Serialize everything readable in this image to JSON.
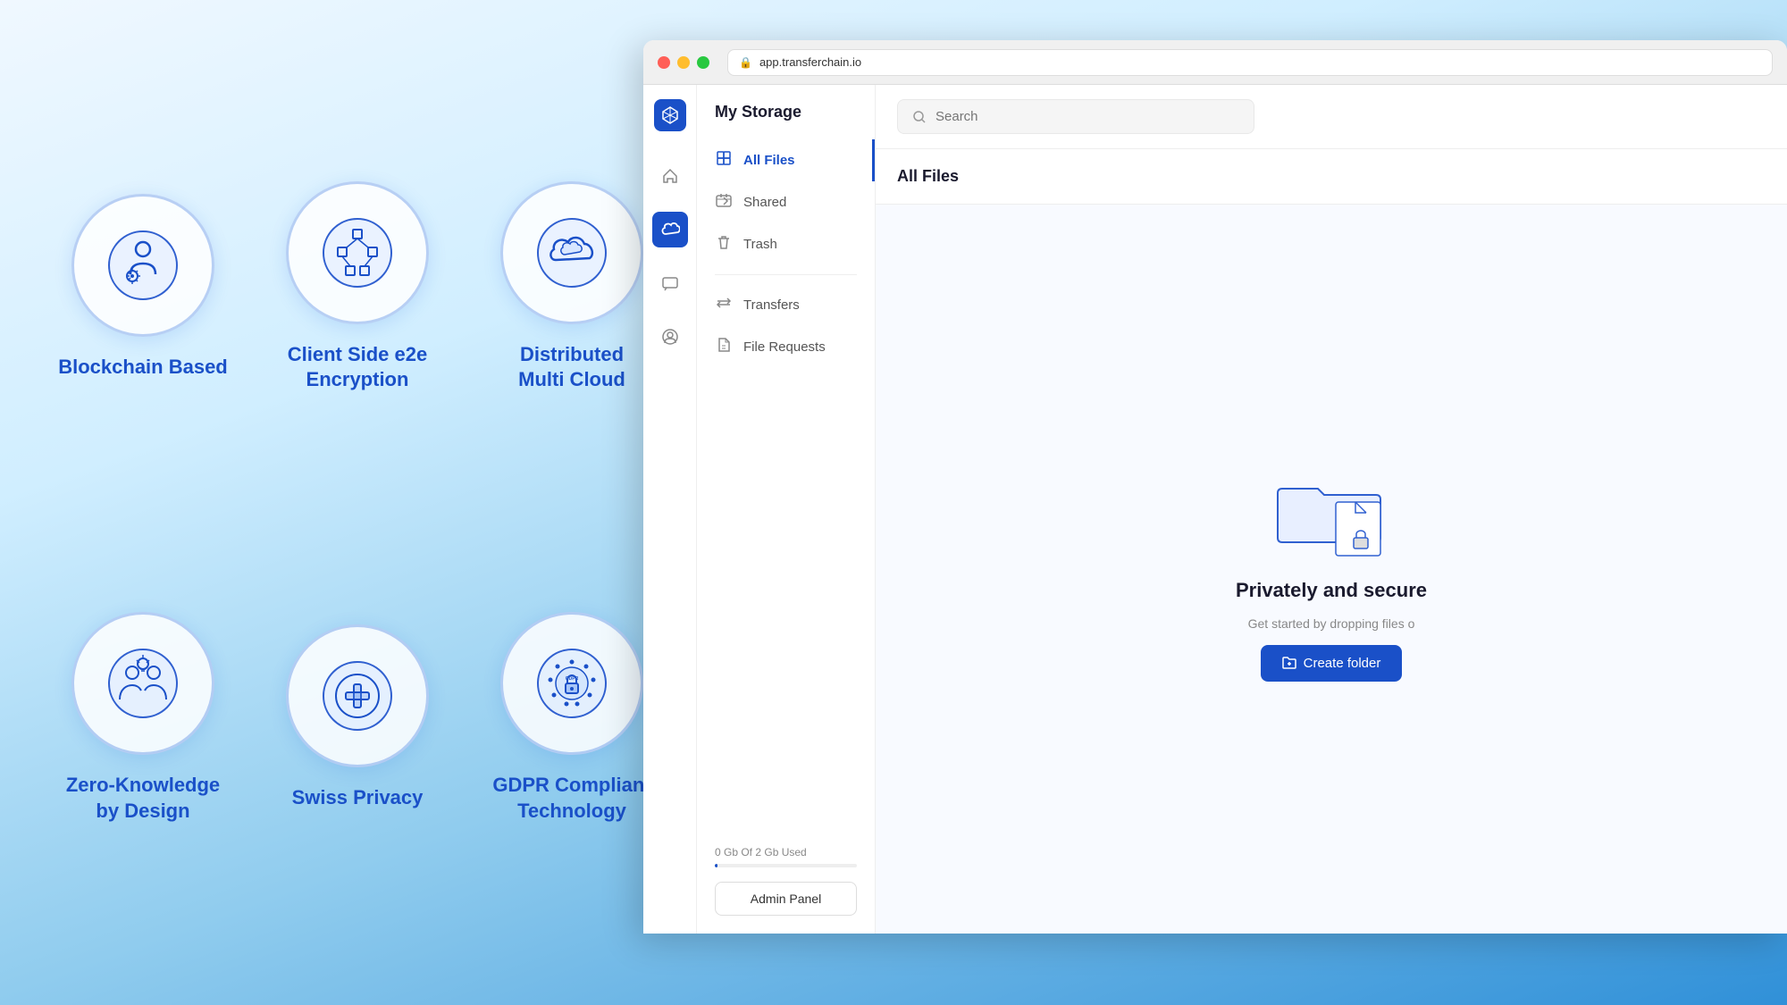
{
  "background": {
    "gradient_start": "#e8f4ff",
    "gradient_end": "#3090d8"
  },
  "features": [
    {
      "id": "blockchain",
      "label": "Blockchain\nBased",
      "icon": "blockchain"
    },
    {
      "id": "encryption",
      "label": "Client Side e2e\nEncryption",
      "icon": "encryption"
    },
    {
      "id": "multicloud",
      "label": "Distributed\nMulti Cloud",
      "icon": "cloud"
    },
    {
      "id": "zeroknowledge",
      "label": "Zero-Knowledge\nby Design",
      "icon": "zeroknowledge"
    },
    {
      "id": "swissprivacy",
      "label": "Swiss Privacy",
      "icon": "cross"
    },
    {
      "id": "gdpr",
      "label": "GDPR Compliant\nTechnology",
      "icon": "gdpr"
    }
  ],
  "browser": {
    "url": "app.transferchain.io"
  },
  "app": {
    "title": "My Storage",
    "nav_items": [
      {
        "id": "all-files",
        "label": "All Files",
        "active": true
      },
      {
        "id": "shared",
        "label": "Shared",
        "active": false
      },
      {
        "id": "trash",
        "label": "Trash",
        "active": false
      },
      {
        "id": "transfers",
        "label": "Transfers",
        "active": false
      },
      {
        "id": "file-requests",
        "label": "File Requests",
        "active": false
      }
    ],
    "search_placeholder": "Search",
    "all_files_title": "All Files",
    "storage": {
      "label": "0 Gb Of 2 Gb Used",
      "used_percent": 2
    },
    "admin_panel_label": "Admin Panel",
    "empty_state": {
      "title": "Privately and secu",
      "subtitle": "Get started by dropping files o",
      "create_folder": "Create folder"
    }
  }
}
